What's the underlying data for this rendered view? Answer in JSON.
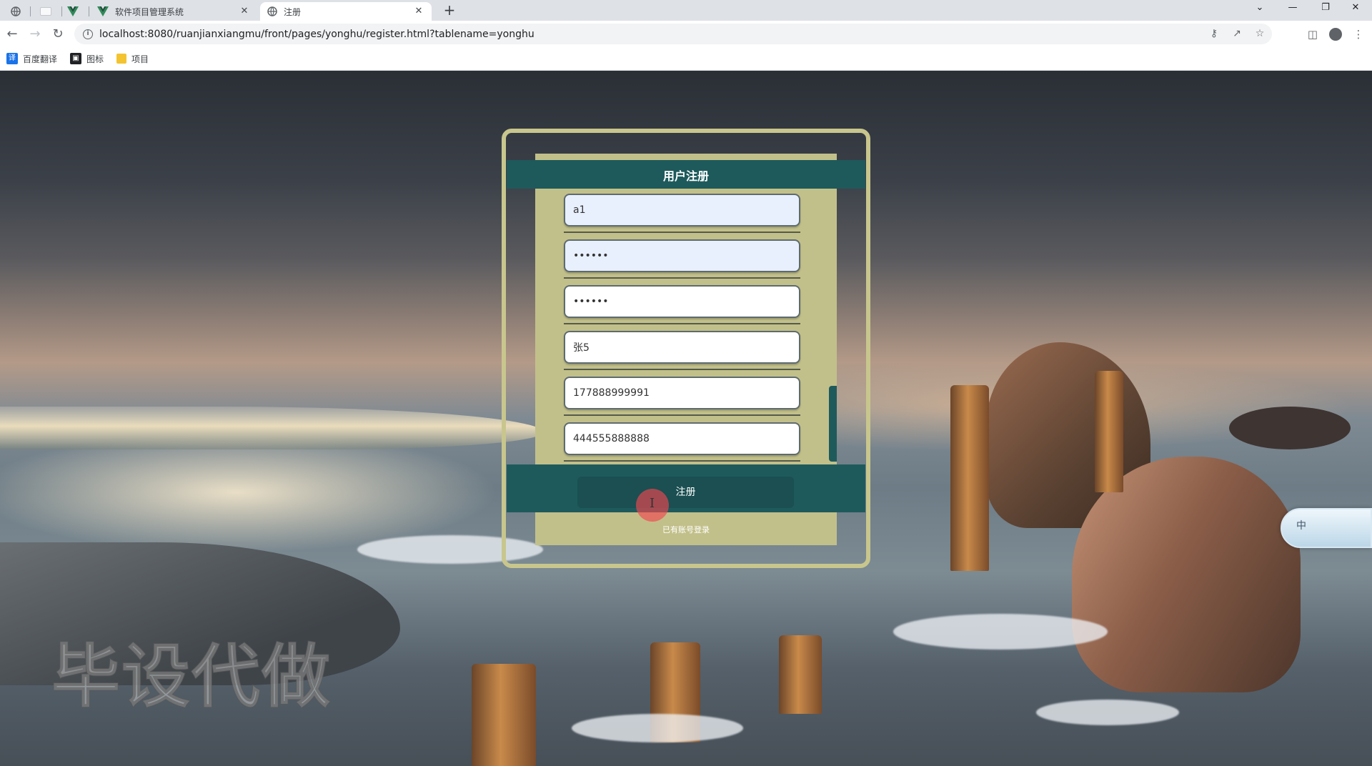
{
  "browser": {
    "tabs": [
      {
        "title": "软件项目管理系统",
        "icon": "vue-logo-icon",
        "close": "✕"
      },
      {
        "title": "注册",
        "icon": "globe-icon",
        "close": "✕"
      }
    ],
    "new_tab": "+",
    "window_controls": {
      "dropdown": "⌄",
      "minimize": "—",
      "restore": "❐",
      "close": "✕"
    },
    "url": "localhost:8080/ruanjianxiangmu/front/pages/yonghu/register.html?tablename=yonghu",
    "bookmarks": [
      {
        "label": "百度翻译",
        "icon": "translate-icon",
        "color": "#1a73e8"
      },
      {
        "label": "图标",
        "icon": "image-icon",
        "color": "#202124"
      },
      {
        "label": "项目",
        "icon": "folder-icon",
        "color": "#f4c430"
      }
    ]
  },
  "form": {
    "title": "用户注册",
    "fields": [
      {
        "name": "account",
        "type": "text",
        "value": "a1",
        "autofill": true
      },
      {
        "name": "password",
        "type": "password",
        "value": "••••••",
        "autofill": true
      },
      {
        "name": "confirm-password",
        "type": "password",
        "value": "••••••",
        "autofill": false
      },
      {
        "name": "real-name",
        "type": "text",
        "value": "张5",
        "autofill": false
      },
      {
        "name": "phone",
        "type": "text",
        "value": "177888999991",
        "autofill": false
      },
      {
        "name": "id-number",
        "type": "text",
        "value": "444555888888",
        "autofill": false
      }
    ],
    "submit_label": "注册",
    "login_link": "已有账号登录"
  },
  "watermark": "毕设代做",
  "ime": {
    "label": "中"
  },
  "colors": {
    "panel": "#c2c08a",
    "frame": "#c8c68d",
    "header": "#1e5a5c",
    "button": "#1b4f51",
    "autofill": "#e8f0fe",
    "cursor": "#f04650"
  }
}
